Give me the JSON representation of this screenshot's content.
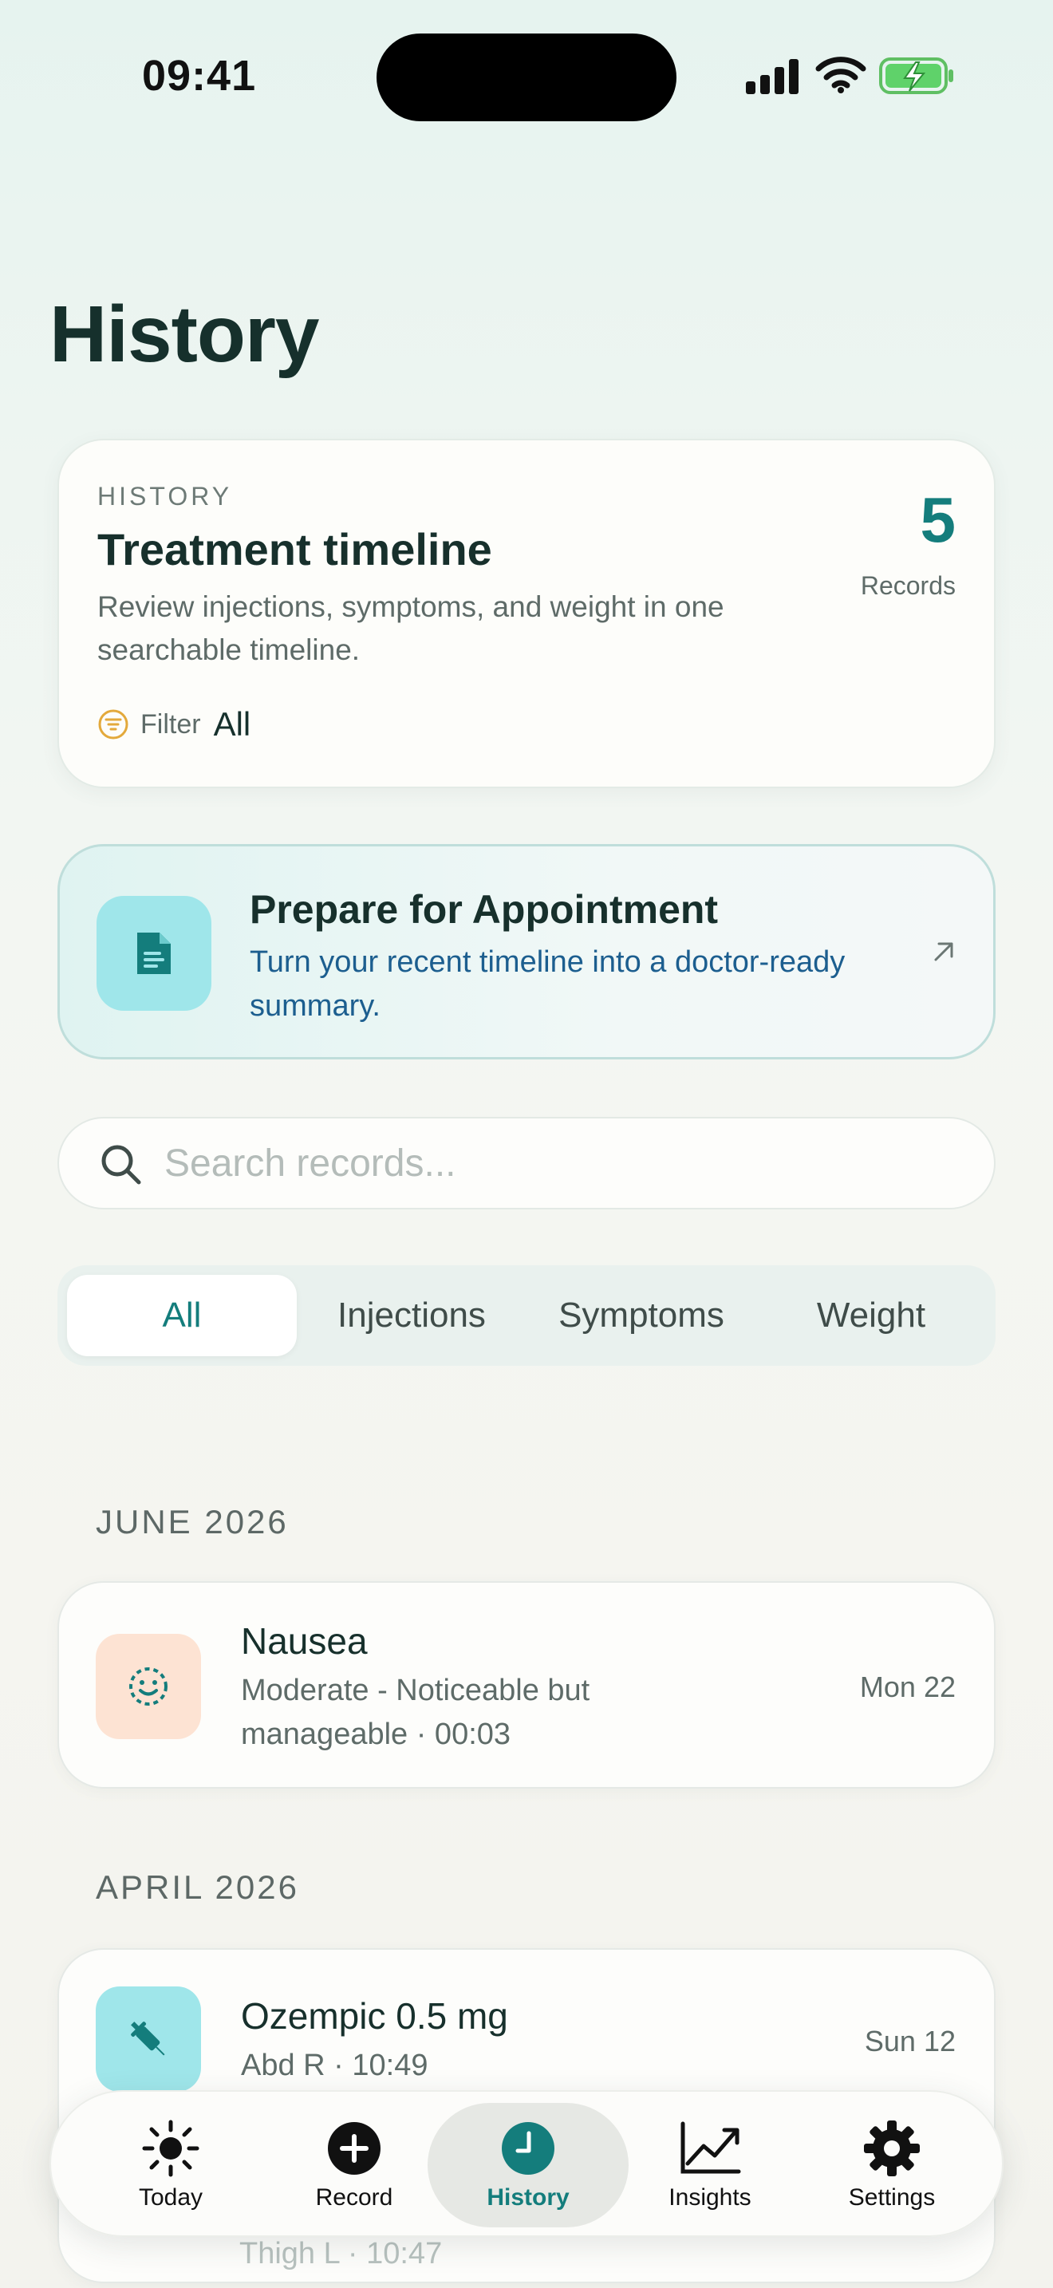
{
  "status_bar": {
    "time": "09:41"
  },
  "page": {
    "title": "History"
  },
  "summary": {
    "eyebrow": "HISTORY",
    "title": "Treatment timeline",
    "description": "Review injections, symptoms, and weight in one searchable timeline.",
    "count": "5",
    "count_label": "Records",
    "filter_label": "Filter",
    "filter_value": "All"
  },
  "appointment": {
    "title": "Prepare for Appointment",
    "description": "Turn your recent timeline into a doctor-ready summary."
  },
  "search": {
    "placeholder": "Search records..."
  },
  "segments": [
    {
      "label": "All",
      "active": true
    },
    {
      "label": "Injections",
      "active": false
    },
    {
      "label": "Symptoms",
      "active": false
    },
    {
      "label": "Weight",
      "active": false
    }
  ],
  "sections": [
    {
      "header": "JUNE 2026",
      "records": [
        {
          "title": "Nausea",
          "subtitle": "Moderate - Noticeable but manageable · 00:03",
          "date": "Mon 22",
          "icon": "smile-icon"
        }
      ]
    },
    {
      "header": "APRIL 2026",
      "records": [
        {
          "title": "Ozempic 0.5 mg",
          "subtitle": "Abd R · 10:49",
          "date": "Sun 12",
          "icon": "syringe-icon"
        },
        {
          "title": "",
          "subtitle": "Thigh L · 10:47",
          "date": "",
          "icon": "syringe-icon"
        }
      ]
    }
  ],
  "tab_bar": [
    {
      "label": "Today",
      "icon": "sun-icon",
      "active": false
    },
    {
      "label": "Record",
      "icon": "plus-circle-icon",
      "active": false
    },
    {
      "label": "History",
      "icon": "clock-icon",
      "active": true
    },
    {
      "label": "Insights",
      "icon": "chart-line-icon",
      "active": false
    },
    {
      "label": "Settings",
      "icon": "gear-icon",
      "active": false
    }
  ],
  "colors": {
    "accent": "#147d7c",
    "link": "#1c5e8f",
    "appointment_icon_bg": "#9fe6ea",
    "symptom_icon_bg": "#fde3d3",
    "filter_icon": "#e3a93b"
  }
}
